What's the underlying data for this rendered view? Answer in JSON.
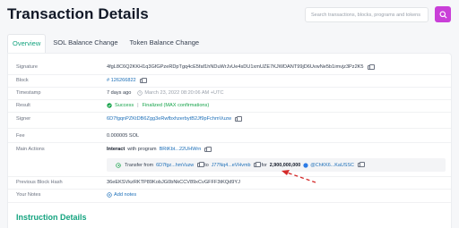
{
  "header": {
    "title": "Transaction Details",
    "search_placeholder": "Search transactions, blocks, programs and tokens"
  },
  "tabs": [
    "Overview",
    "SOL Balance Change",
    "Token Balance Change"
  ],
  "details": {
    "signature_label": "Signature",
    "signature": "4fgL8C6Q2KKH1q3GfGPzeRDpTgq4cE5faf1hNDuWrJvUe4sDU1xmUZE7KJWDANT99jD6UvwNe5b1imvjz3Pz2K5",
    "block_label": "Block",
    "block": "# 126266822",
    "timestamp_label": "Timestamp",
    "timestamp_ago": "7 days ago",
    "timestamp": "March 23, 2022 08:20:06 AM +UTC",
    "result_label": "Result",
    "result_success": "Success",
    "result_finalized": "Finalized (MAX confirmations)",
    "signer_label": "Signer",
    "signer": "6D7fgqnPZKtDB6Zgg3eRwfbxhzerbytB2Jf9pFchmVuzw",
    "fee_label": "Fee",
    "fee": "0.000005 SOL",
    "main_actions_label": "Main Actions",
    "interact_text": "Interact",
    "with_program_text": "with program",
    "program": "BRtKbt...22UHWrn",
    "transfer_from_text": "Transfer from",
    "transfer_from": "6D7fgz...hmVuzw",
    "to_text": "to",
    "transfer_to": "J77Nq4...eVHvmb",
    "for_text": "for",
    "amount": "2,900,000,000",
    "token": "@ChKK6...KaUSSC",
    "prev_hash_label": "Previous Block Hash",
    "prev_hash": "36eEKSVkzRKTP89KobJG0bNkCCV89xCvGFFF3tKQd9YJ",
    "notes_label": "Your Notes",
    "add_notes": "Add notes"
  },
  "section_title": "Instruction Details",
  "colors": {
    "accent": "#14a37f",
    "link": "#1d6fb8",
    "search_button": "#c93fd8",
    "arrow": "#d42a2a"
  }
}
